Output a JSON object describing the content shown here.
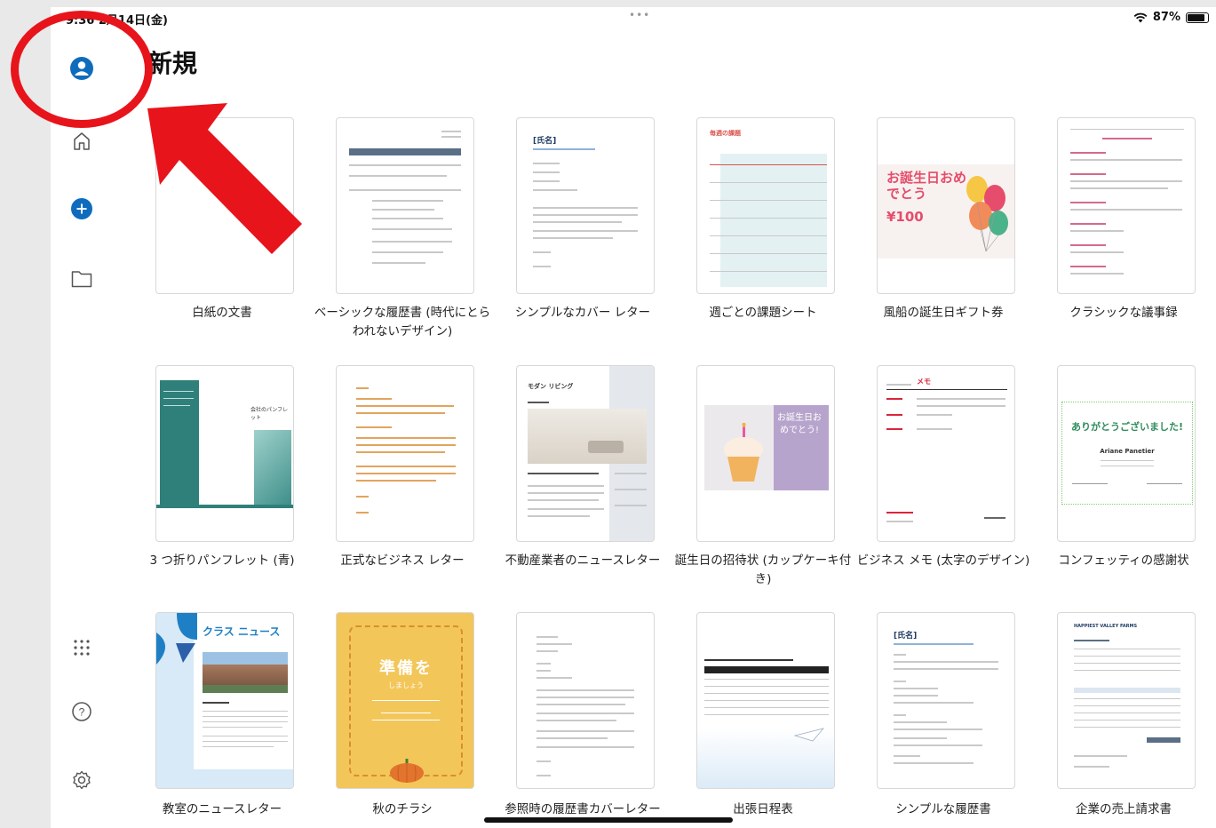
{
  "status_bar": {
    "time": "9:36  2月14日(金)",
    "multitask": "•••",
    "battery_percent": "87%",
    "battery_level": 0.87
  },
  "sidebar": {
    "items": [
      {
        "name": "account-icon"
      },
      {
        "name": "home-icon"
      },
      {
        "name": "new-icon"
      },
      {
        "name": "folder-icon"
      },
      {
        "name": "apps-grid-icon"
      },
      {
        "name": "help-icon"
      },
      {
        "name": "settings-icon"
      }
    ]
  },
  "page": {
    "title": "新規"
  },
  "templates": [
    {
      "label": "白紙の文書"
    },
    {
      "label": "ベーシックな履歴書 (時代にとらわれないデザイン)"
    },
    {
      "label": "シンプルなカバー レター",
      "thumb_heading": "[氏名]"
    },
    {
      "label": "週ごとの課題シート",
      "thumb_heading": "毎週の課題"
    },
    {
      "label": "風船の誕生日ギフト券",
      "thumb_heading": "お誕生日おめでとう",
      "thumb_price": "¥100"
    },
    {
      "label": "クラシックな議事録"
    },
    {
      "label": "3 つ折りパンフレット (青)",
      "thumb_heading": "会社のパンフレット"
    },
    {
      "label": "正式なビジネス レター"
    },
    {
      "label": "不動産業者のニュースレター",
      "thumb_heading": "モダン リビング"
    },
    {
      "label": "誕生日の招待状 (カップケーキ付き)",
      "thumb_heading": "お誕生日おめでとう!"
    },
    {
      "label": "ビジネス メモ (太字のデザイン)",
      "thumb_heading": "メモ"
    },
    {
      "label": "コンフェッティの感謝状",
      "thumb_heading": "ありがとうございました!",
      "thumb_name": "Ariane Panetier"
    },
    {
      "label": "教室のニュースレター",
      "thumb_heading": "クラス ニュース"
    },
    {
      "label": "秋のチラシ",
      "thumb_heading": "準備を",
      "thumb_sub": "しましょう"
    },
    {
      "label": "参照時の履歴書カバーレター"
    },
    {
      "label": "出張日程表"
    },
    {
      "label": "シンプルな履歴書",
      "thumb_heading": "[氏名]"
    },
    {
      "label": "企業の売上請求書",
      "thumb_heading": "HAPPIEST VALLEY FARMS"
    }
  ],
  "colors": {
    "accent": "#0f6cbd",
    "annotation": "#e8141b"
  }
}
